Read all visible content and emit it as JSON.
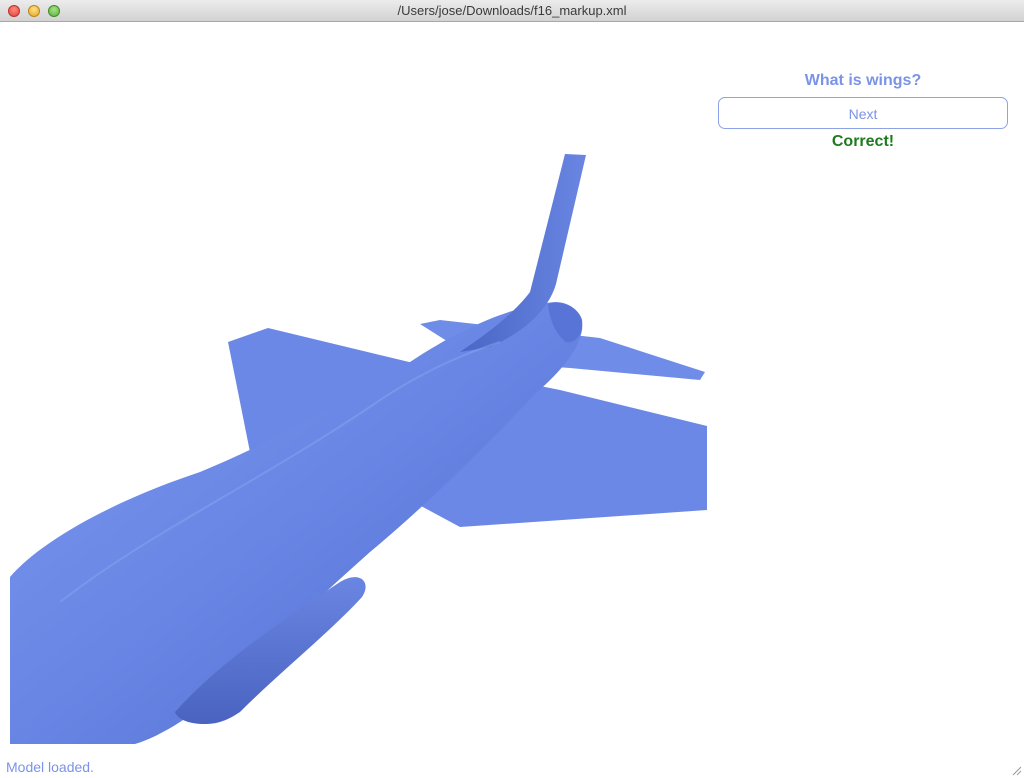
{
  "window": {
    "title": "/Users/jose/Downloads/f16_markup.xml"
  },
  "quiz": {
    "question": "What is wings?",
    "next_label": "Next",
    "feedback": "Correct!"
  },
  "status": {
    "message": "Model loaded."
  },
  "colors": {
    "model_blue": "#6b88e6",
    "accent_text": "#7b93e6",
    "correct_green": "#1f7a1f"
  },
  "icons": {
    "close": "close-icon",
    "minimize": "minimize-icon",
    "zoom": "zoom-icon",
    "resize": "resize-grip-icon"
  }
}
